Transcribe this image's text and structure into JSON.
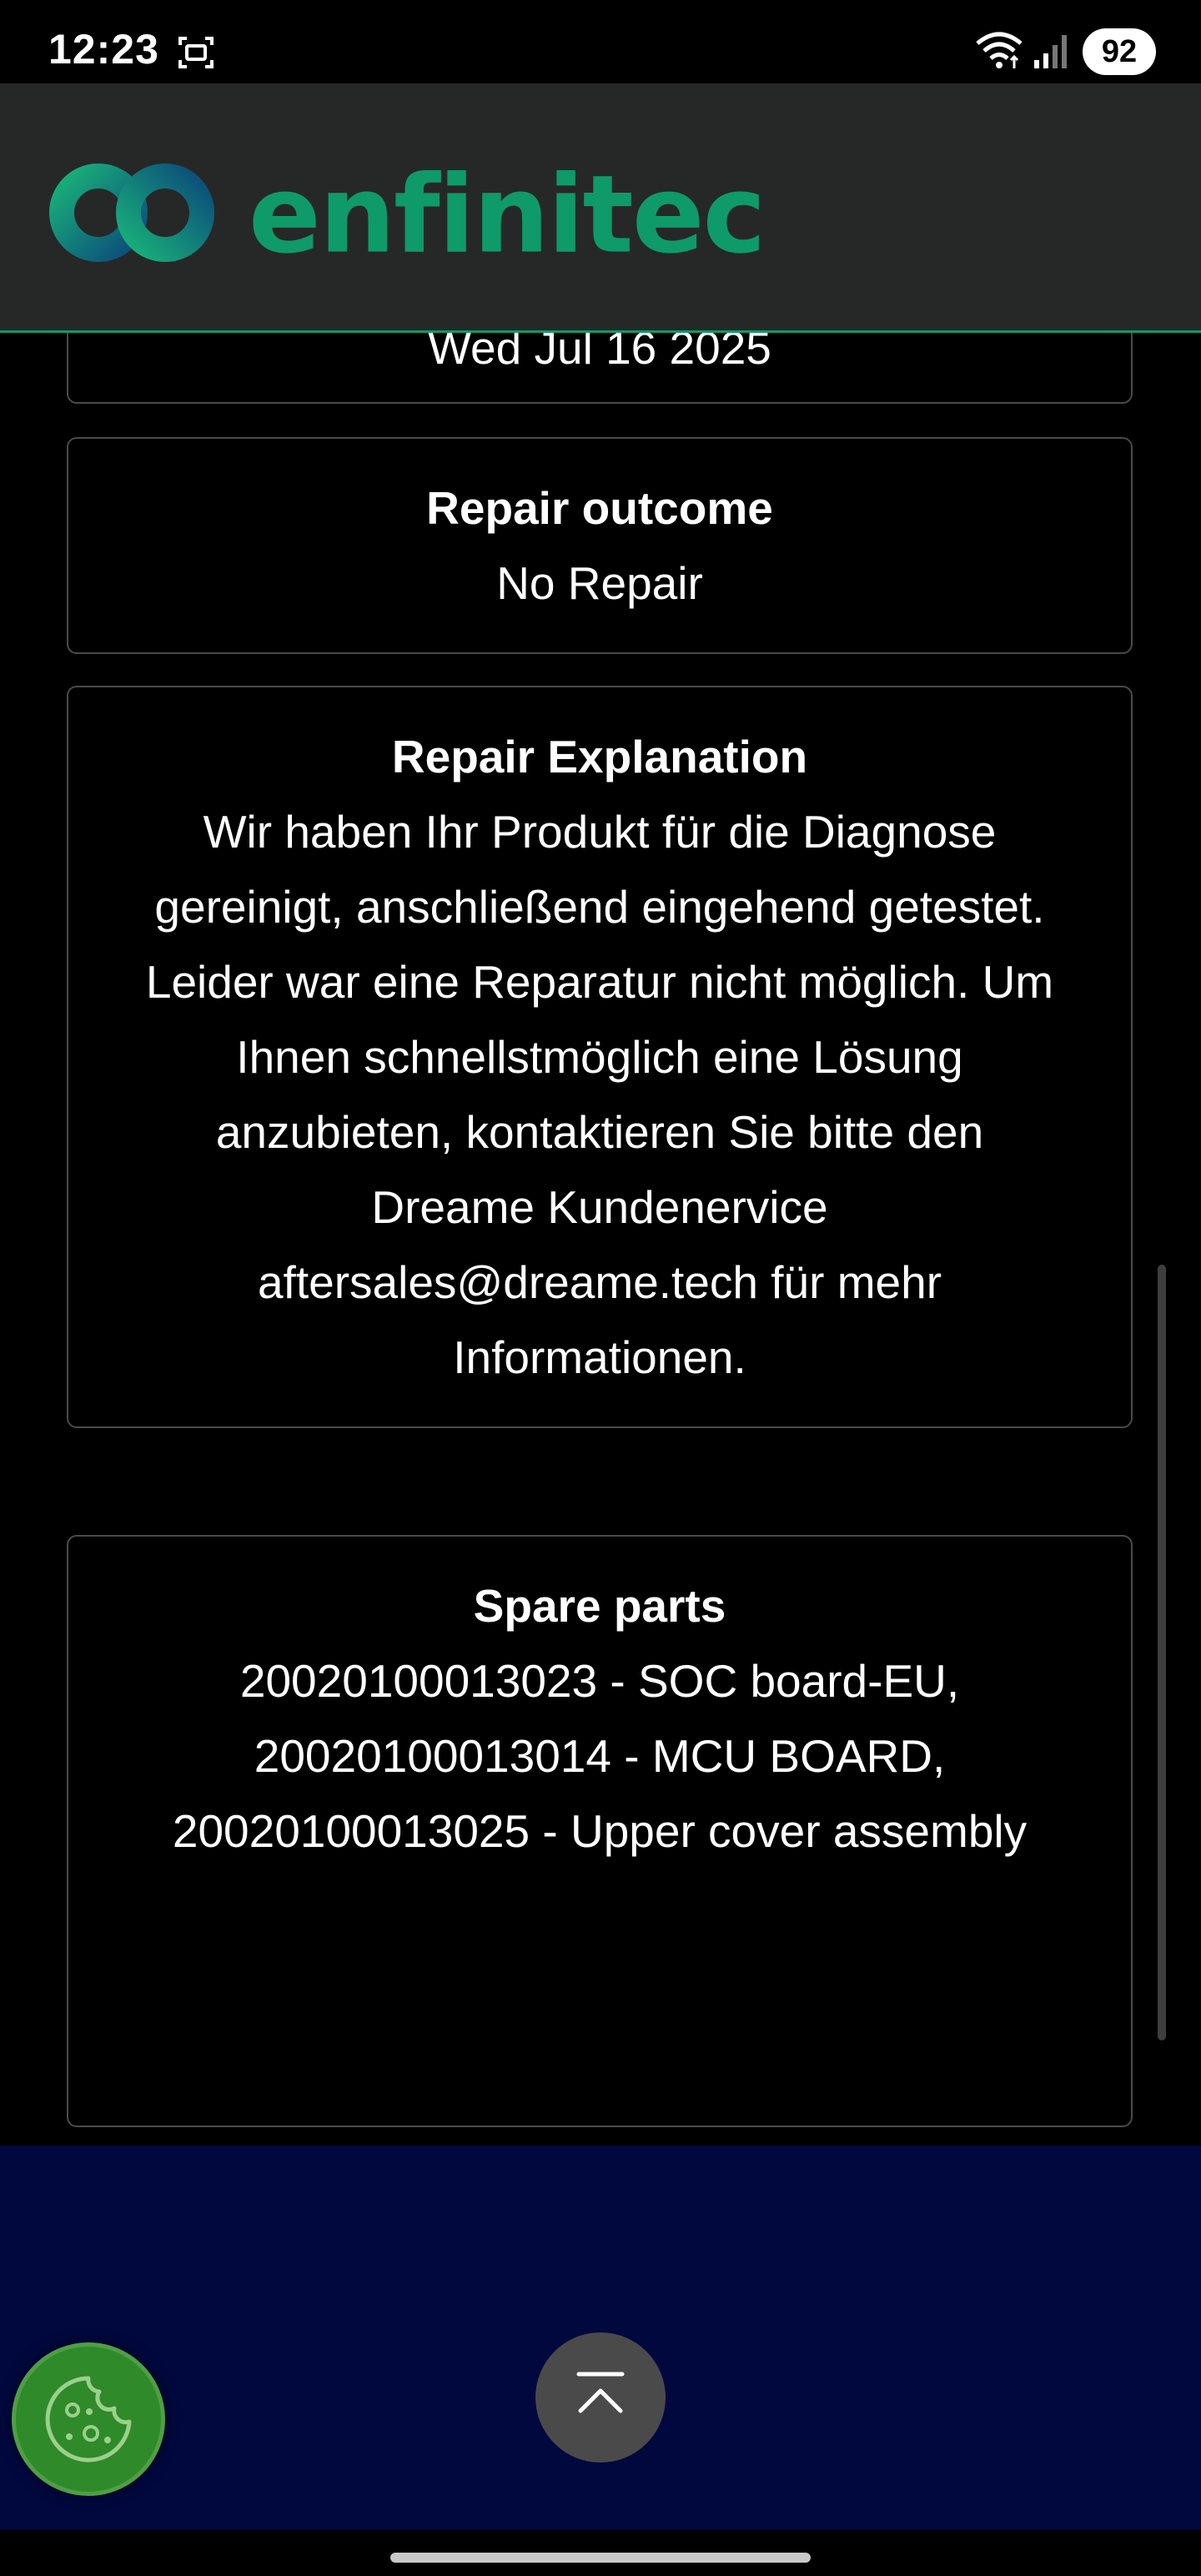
{
  "status_bar": {
    "time": "12:23",
    "battery": "92",
    "icons": [
      "screenshot-icon",
      "wifi-icon",
      "signal-icon"
    ]
  },
  "header": {
    "brand": "enfinitec",
    "brand_color": "#0f9a6a"
  },
  "cards": {
    "date_value": "Wed Jul 16 2025",
    "outcome": {
      "title": "Repair outcome",
      "value": "No Repair"
    },
    "explanation": {
      "title": "Repair Explanation",
      "lines": [
        "Wir haben Ihr Produkt für die Diagnose",
        "gereinigt, anschließend eingehend getestet.",
        "Leider war eine Reparatur nicht möglich. Um",
        "Ihnen schnellstmöglich eine Lösung",
        "anzubieten, kontaktieren Sie bitte den",
        "Dreame Kundenervice",
        "aftersales@dreame.tech für mehr",
        "Informationen."
      ]
    },
    "spares": {
      "title": "Spare parts",
      "lines": [
        "20020100013023 - SOC board-EU,",
        "20020100013014 - MCU BOARD,",
        "20020100013025 - Upper cover assembly"
      ]
    }
  },
  "colors": {
    "background": "#000000",
    "header_bg": "#262828",
    "footer_bg": "#00083e",
    "cookie_bg": "#2f8a2a"
  }
}
